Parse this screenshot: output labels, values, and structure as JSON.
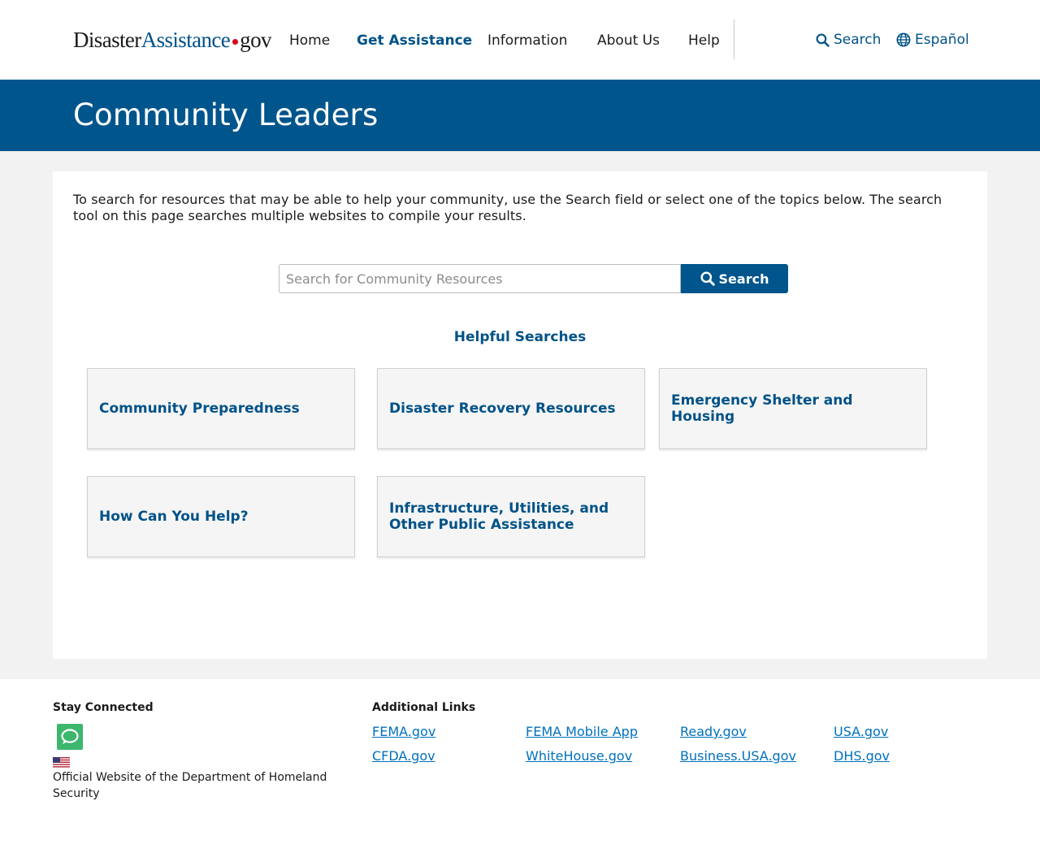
{
  "header": {
    "logo": {
      "part1": "Disaster",
      "part2": "Assistance",
      "part3": "gov"
    },
    "nav": [
      {
        "label": "Home",
        "active": false
      },
      {
        "label": "Get Assistance",
        "active": true
      },
      {
        "label": "Information",
        "active": false
      },
      {
        "label": "About Us",
        "active": false
      },
      {
        "label": "Help",
        "active": false
      }
    ],
    "search_link": "Search",
    "language_link": "Español"
  },
  "banner": {
    "title": "Community Leaders"
  },
  "main": {
    "intro": "To search for resources that may be able to help your community, use the Search field or select one of the topics below. The search tool on this page searches multiple websites to compile your results.",
    "search": {
      "placeholder": "Search for Community Resources",
      "value": "",
      "button_label": "Search"
    },
    "helpful_heading": "Helpful Searches",
    "topics": [
      "Community Preparedness",
      "Disaster Recovery Resources",
      "Emergency Shelter and Housing",
      "How Can You Help?",
      "Infrastructure, Utilities, and Other Public Assistance"
    ]
  },
  "footer": {
    "stay_connected": "Stay Connected",
    "official_text": "Official Website of the Department of Homeland Security",
    "additional_links_title": "Additional Links",
    "links": [
      "FEMA.gov",
      "FEMA Mobile App",
      "Ready.gov",
      "USA.gov",
      "CFDA.gov",
      "WhiteHouse.gov",
      "Business.USA.gov",
      "DHS.gov"
    ]
  },
  "colors": {
    "brand_blue": "#00558c",
    "link_blue": "#0071bc",
    "chat_green": "#3db66e"
  },
  "icons": [
    "search-icon",
    "globe-icon",
    "chat-icon",
    "us-flag-icon"
  ]
}
